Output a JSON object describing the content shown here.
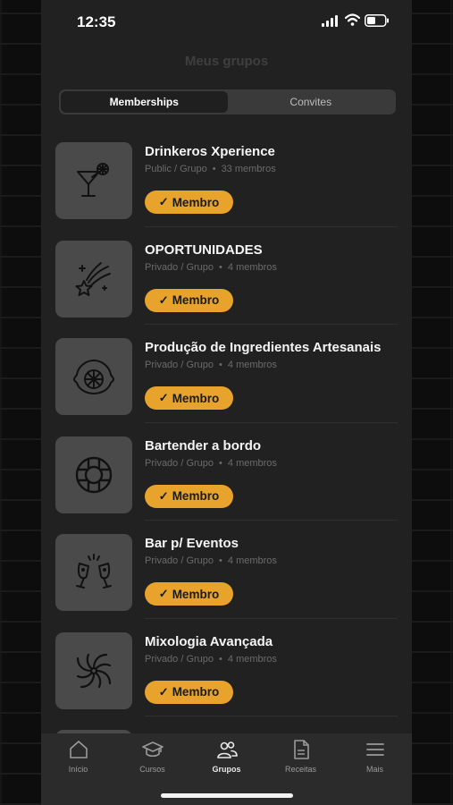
{
  "status_bar": {
    "time": "12:35"
  },
  "header": {
    "title": "Meus grupos"
  },
  "segmented": {
    "memberships": "Memberships",
    "invites": "Convites"
  },
  "groups": [
    {
      "name": "Drinkeros Xperience",
      "visibility": "Public / Grupo",
      "members": "33 membros",
      "badge": "Membro",
      "icon": "cocktail-icon"
    },
    {
      "name": "OPORTUNIDADES",
      "visibility": "Privado / Grupo",
      "members": "4 membros",
      "badge": "Membro",
      "icon": "shooting-star-icon"
    },
    {
      "name": "Produção de Ingredientes Artesanais",
      "visibility": "Privado / Grupo",
      "members": "4 membros",
      "badge": "Membro",
      "icon": "lemon-icon"
    },
    {
      "name": "Bartender a bordo",
      "visibility": "Privado / Grupo",
      "members": "4 membros",
      "badge": "Membro",
      "icon": "lifebuoy-icon"
    },
    {
      "name": "Bar p/ Eventos",
      "visibility": "Privado / Grupo",
      "members": "4 membros",
      "badge": "Membro",
      "icon": "champagne-toast-icon"
    },
    {
      "name": "Mixologia Avançada",
      "visibility": "Privado / Grupo",
      "members": "4 membros",
      "badge": "Membro",
      "icon": "swirl-icon"
    }
  ],
  "tab_bar": {
    "home": "Início",
    "courses": "Cursos",
    "groups": "Grupos",
    "recipes": "Receitas",
    "more": "Mais"
  }
}
